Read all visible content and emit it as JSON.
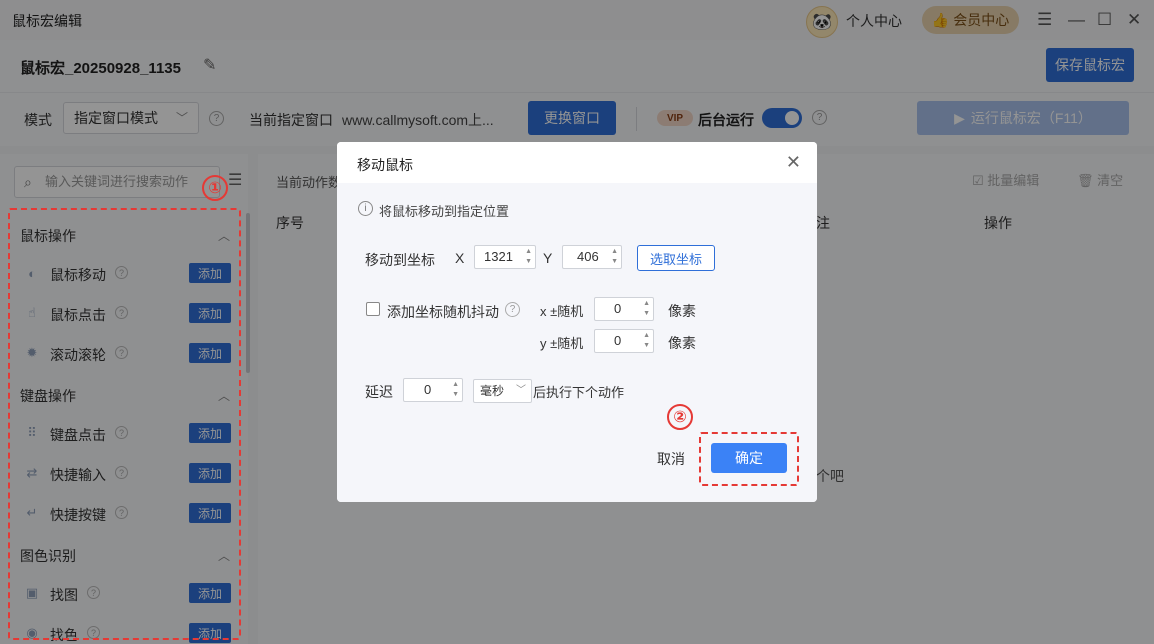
{
  "titlebar": {
    "title": "鼠标宏编辑",
    "personal_center": "个人中心",
    "vip_center": "会员中心"
  },
  "macro": {
    "name": "鼠标宏_20250928_1135",
    "save_label": "保存鼠标宏"
  },
  "mode_row": {
    "mode_label": "模式",
    "mode_value": "指定窗口模式",
    "current_window_label": "当前指定窗口",
    "current_window_value": "www.callmysoft.com上...",
    "change_window_label": "更换窗口",
    "vip_tag": "VIP",
    "background_run_label": "后台运行",
    "background_run_on": true,
    "run_label": "运行鼠标宏（F11）"
  },
  "left_panel": {
    "search_placeholder": "输入关键词进行搜索动作",
    "groups": [
      {
        "title": "鼠标操作",
        "items": [
          {
            "label": "鼠标移动",
            "add": "添加"
          },
          {
            "label": "鼠标点击",
            "add": "添加"
          },
          {
            "label": "滚动滚轮",
            "add": "添加"
          }
        ]
      },
      {
        "title": "键盘操作",
        "items": [
          {
            "label": "键盘点击",
            "add": "添加"
          },
          {
            "label": "快捷输入",
            "add": "添加"
          },
          {
            "label": "快捷按键",
            "add": "添加"
          }
        ]
      },
      {
        "title": "图色识别",
        "items": [
          {
            "label": "找图",
            "add": "添加"
          },
          {
            "label": "找色",
            "add": "添加"
          }
        ]
      }
    ]
  },
  "right_panel": {
    "current_actions": "当前动作数",
    "batch_edit": "批量编辑",
    "clear": "清空",
    "col_seq": "序号",
    "col_note": "注",
    "col_op": "操作",
    "empty_tip": "个吧"
  },
  "dialog": {
    "title": "移动鼠标",
    "info": "将鼠标移动到指定位置",
    "move_to_label": "移动到坐标",
    "x_label": "X",
    "x_value": "1321",
    "y_label": "Y",
    "y_value": "406",
    "pick_label": "选取坐标",
    "jitter_label": "添加坐标随机抖动",
    "jitter_x_label": "x ±随机",
    "jitter_x_value": "0",
    "jitter_y_label": "y ±随机",
    "jitter_y_value": "0",
    "pixel_unit": "像素",
    "delay_label": "延迟",
    "delay_value": "0",
    "delay_unit": "毫秒",
    "delay_suffix": "后执行下个动作",
    "cancel_label": "取消",
    "ok_label": "确定"
  },
  "annotations": {
    "badge_1": "①",
    "badge_2": "②",
    "color": "#e53935"
  }
}
